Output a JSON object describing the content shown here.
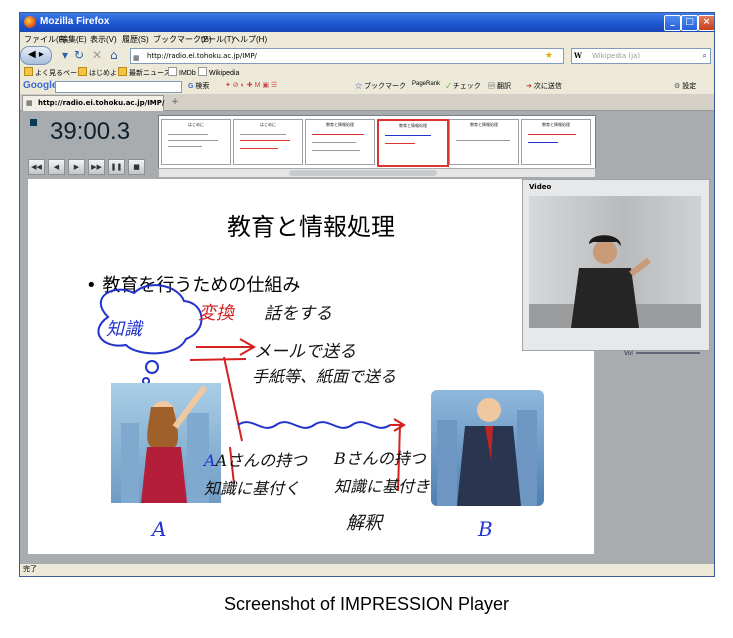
{
  "window": {
    "title": "Mozilla Firefox"
  },
  "menu": [
    "ファイル(F)",
    "編集(E)",
    "表示(V)",
    "履歴(S)",
    "ブックマーク(B)",
    "ツール(T)",
    "ヘルプ(H)"
  ],
  "nav": {
    "url": "http://radio.ei.tohoku.ac.jp/IMP/",
    "search_placeholder": "Wikipedia (ja)",
    "search_engine": "W"
  },
  "bookmarks": [
    "よく見るページ",
    "はじめよう",
    "最新ニュース",
    "IMDb",
    "Wikipedia"
  ],
  "googlebar": {
    "logo": "Google",
    "search": "検索",
    "bookmarks": "ブックマーク",
    "pagerank": "PageRank",
    "check": "チェック",
    "translate": "翻訳",
    "send": "次に送信",
    "settings": "設定"
  },
  "tab": {
    "label": "http://radio.ei.tohoku.ac.jp/IMP/"
  },
  "player": {
    "time": "39:00.3",
    "thumbnails": [
      {
        "title": "はじめに"
      },
      {
        "title": "はじめに"
      },
      {
        "title": "教育と情報処理"
      },
      {
        "title": "教育と情報処理"
      },
      {
        "title": "教育と情報処理"
      },
      {
        "title": "教育と情報処理"
      }
    ],
    "slide": {
      "title": "教育と情報処理",
      "bullet": "• 教育を行うための仕組み",
      "ink": {
        "knowledge": "知識",
        "transform": "変換",
        "speak": "話をする",
        "mail": "メールで送る",
        "letter": "手紙等、紙面で送る",
        "a_has": "Aさんの持つ",
        "a_based": "知識に基付く",
        "b_has": "Bさんの持つ",
        "b_based": "知識に基付き",
        "interpret": "解釈",
        "label_a": "A",
        "label_b": "B"
      }
    },
    "video_label": "Video",
    "vol_label": "Vol"
  },
  "status": "完了",
  "caption": "Screenshot of IMPRESSION Player",
  "colors": {
    "ink_blue": "#2233cc",
    "ink_red": "#d42020",
    "ink_black": "#111111"
  }
}
